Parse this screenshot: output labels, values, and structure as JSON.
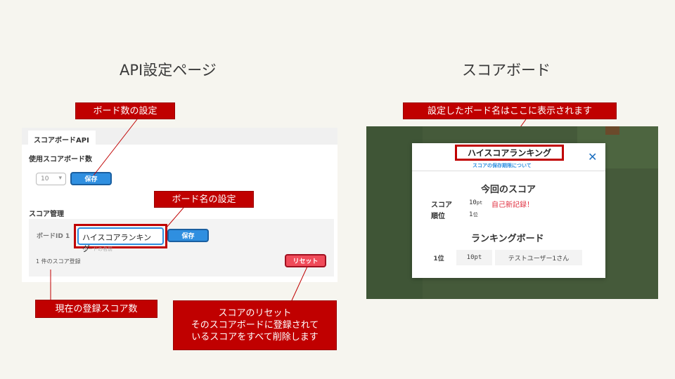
{
  "left": {
    "title": "API設定ページ",
    "tab_label": "スコアボードAPI",
    "board_count_label": "使用スコアボード数",
    "board_count_value": "10",
    "save_label": "保存",
    "score_manage_label": "スコア管理",
    "board_id_label": "ボードID 1",
    "board_name_value": "ハイスコアランキング",
    "save2_label": "保存",
    "helper_text": "ボードの名前",
    "score_count_text": "1 件のスコア登録",
    "reset_label": "リセット"
  },
  "right": {
    "title": "スコアボード",
    "board_name": "ハイスコアランキング",
    "retention_link": "スコアの保存期限について",
    "current_score_heading": "今回のスコア",
    "score_label": "スコア",
    "score_value": "10",
    "score_unit": "pt",
    "new_record": "自己新記録！",
    "rank_label": "順位",
    "rank_value": "1",
    "rank_unit": "位",
    "ranking_heading": "ランキングボード",
    "ranking_rows": [
      {
        "rank": "1位",
        "score": "10pt",
        "name": "テストユーザー1さん"
      }
    ]
  },
  "callouts": {
    "board_count": "ボード数の設定",
    "board_name": "ボード名の設定",
    "current_count": "現在の登録スコア数",
    "reset_line1": "スコアのリセット",
    "reset_line2": "そのスコアボードに登録されて",
    "reset_line3": "いるスコアをすべて削除します",
    "display_name": "設定したボード名はここに表示されます"
  },
  "colors": {
    "accent_blue": "#2f8fe0",
    "callout_red": "#c00000",
    "reset_red": "#f04b5a",
    "background": "#f6f5ef"
  }
}
